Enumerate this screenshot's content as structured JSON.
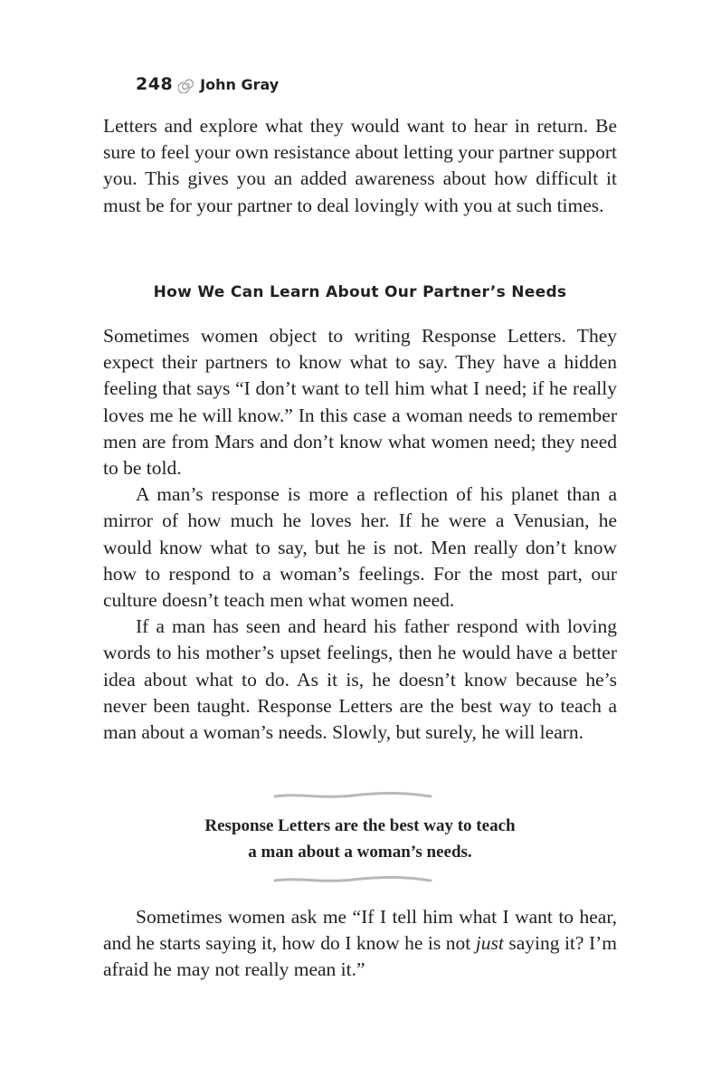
{
  "header": {
    "page_number": "248",
    "author": "John Gray",
    "ornament_icon": "spiral-icon"
  },
  "intro_paragraph": "Letters and explore what they would want to hear in return. Be sure to feel your own resistance about letting your partner support you. This gives you an added awareness about how difficult it must be for your partner to deal lovingly with you at such times.",
  "section": {
    "heading": "How We Can Learn About Our Partner’s Needs",
    "paragraphs": [
      "Sometimes women object to writing Response Letters. They expect their partners to know what to say. They have a hidden feeling that says “I don’t want to tell him what I need; if he really loves me he will know.” In this case a woman needs to remember men are from Mars and don’t know what women need; they need to be told.",
      "A man’s response is more a reflection of his planet than a mirror of how much he loves her. If he were a Venusian, he would know what to say, but he is not. Men really don’t know how to respond to a woman’s feelings. For the most part, our culture doesn’t teach men what women need.",
      "If a man has seen and heard his father respond with lov­ing words to his mother’s upset feelings, then he would have a better idea about what to do. As it is, he doesn’t know because he’s never been taught. Response Letters are the best way to teach a man about a woman’s needs. Slowly, but surely, he will learn."
    ]
  },
  "pullquote": {
    "line_1": "Response Letters are the best way to teach",
    "line_2": "a man about a woman’s needs."
  },
  "closing_paragraph": {
    "before_emphasis": "Sometimes women ask me “If I tell him what I want to hear, and he starts saying it, how do I know he is not ",
    "emphasis": "just",
    "after_emphasis": " say­ing it? I’m afraid he may not really mean it.”"
  }
}
